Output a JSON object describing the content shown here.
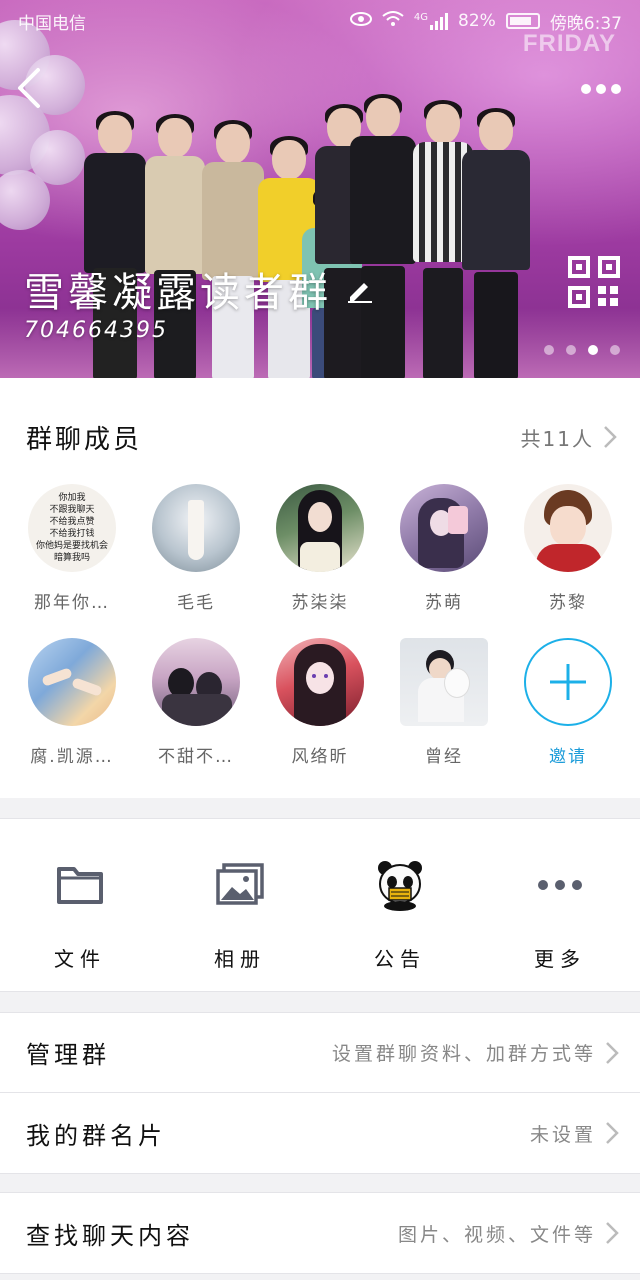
{
  "status_bar": {
    "carrier": "中国电信",
    "network": "4G",
    "battery": "82%",
    "battery_level": 0.82,
    "time": "傍晚6:37"
  },
  "header": {
    "group_name": "雪馨凝露读者群",
    "group_id": "704664395",
    "banner_backdrop_text": "FRIDAY",
    "page_indicator": {
      "count": 4,
      "active_index": 2
    }
  },
  "members": {
    "title": "群聊成员",
    "count": "共11人",
    "list": [
      {
        "name": "那年你…",
        "avatar": "text-avatar",
        "avatar_text": [
          "你加我",
          "不跟我聊天",
          "不给我点赞",
          "不给我打钱",
          "你他妈是要找机会",
          "暗算我吗"
        ]
      },
      {
        "name": "毛毛",
        "avatar": "fantasy-girl"
      },
      {
        "name": "苏柒柒",
        "avatar": "black-hair-girl"
      },
      {
        "name": "苏萌",
        "avatar": "purple-girl"
      },
      {
        "name": "苏黎",
        "avatar": "anime-boy"
      },
      {
        "name": "腐.凯源…",
        "avatar": "hands-blue"
      },
      {
        "name": "不甜不…",
        "avatar": "couple-photo"
      },
      {
        "name": "风络昕",
        "avatar": "anime-girl-red"
      },
      {
        "name": "曾经",
        "avatar": "boy-with-bear"
      }
    ],
    "invite_label": "邀请"
  },
  "tools": [
    {
      "label": "文件",
      "icon": "folder-icon"
    },
    {
      "label": "相册",
      "icon": "album-icon"
    },
    {
      "label": "公告",
      "icon": "panda-announcement-icon"
    },
    {
      "label": "更多",
      "icon": "more-dots-icon"
    }
  ],
  "settings": [
    {
      "title": "管理群",
      "value": "设置群聊资料、加群方式等"
    },
    {
      "title": "我的群名片",
      "value": "未设置"
    },
    {
      "title": "查找聊天内容",
      "value": "图片、视频、文件等"
    }
  ],
  "colors": {
    "accent": "#1cb0e8",
    "banner": "#b44fb2",
    "icon_gray": "#5a5f6e"
  }
}
